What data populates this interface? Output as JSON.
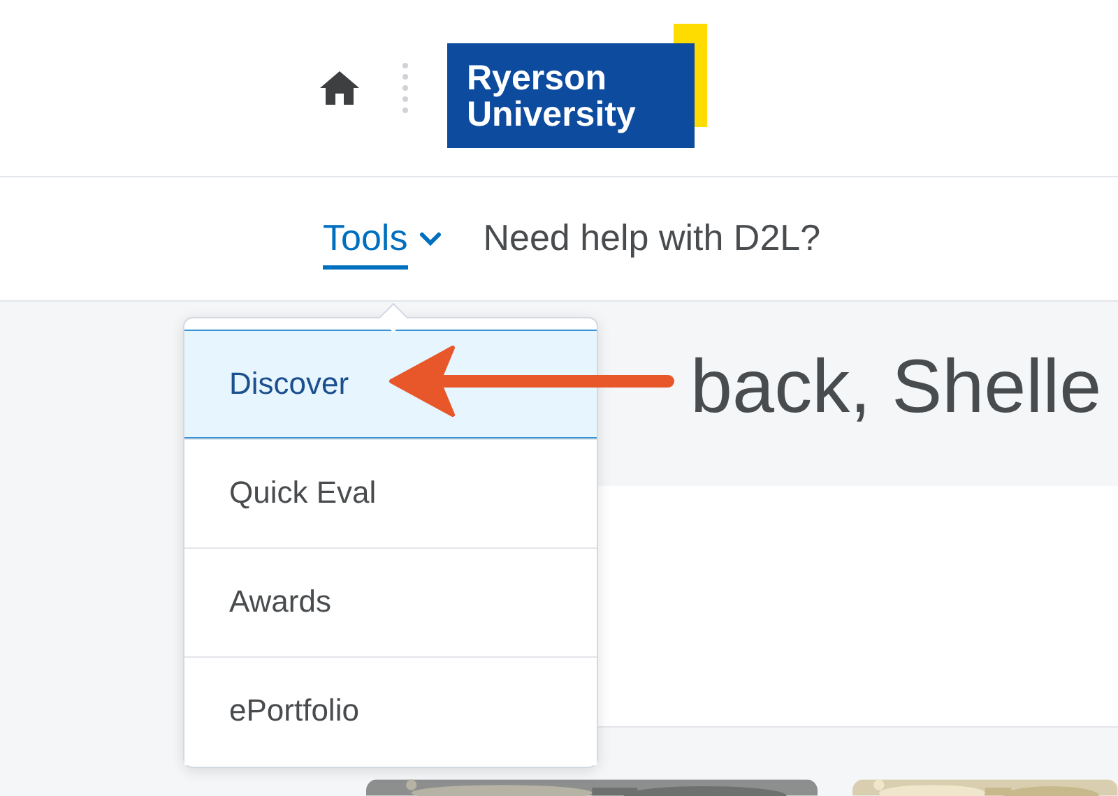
{
  "header": {
    "logo": {
      "line_1": "Ryerson",
      "line_2": "University"
    }
  },
  "nav": {
    "items": [
      {
        "label": "Tools",
        "kind": "dropdown",
        "selected": true
      },
      {
        "label": "Need help with D2L?",
        "kind": "link",
        "selected": false
      }
    ]
  },
  "dropdown": {
    "items": [
      {
        "label": "Discover",
        "selected": true
      },
      {
        "label": "Quick Eval",
        "selected": false
      },
      {
        "label": "Awards",
        "selected": false
      },
      {
        "label": "ePortfolio",
        "selected": false
      }
    ]
  },
  "welcome": {
    "heading": "back, Shelle"
  }
}
